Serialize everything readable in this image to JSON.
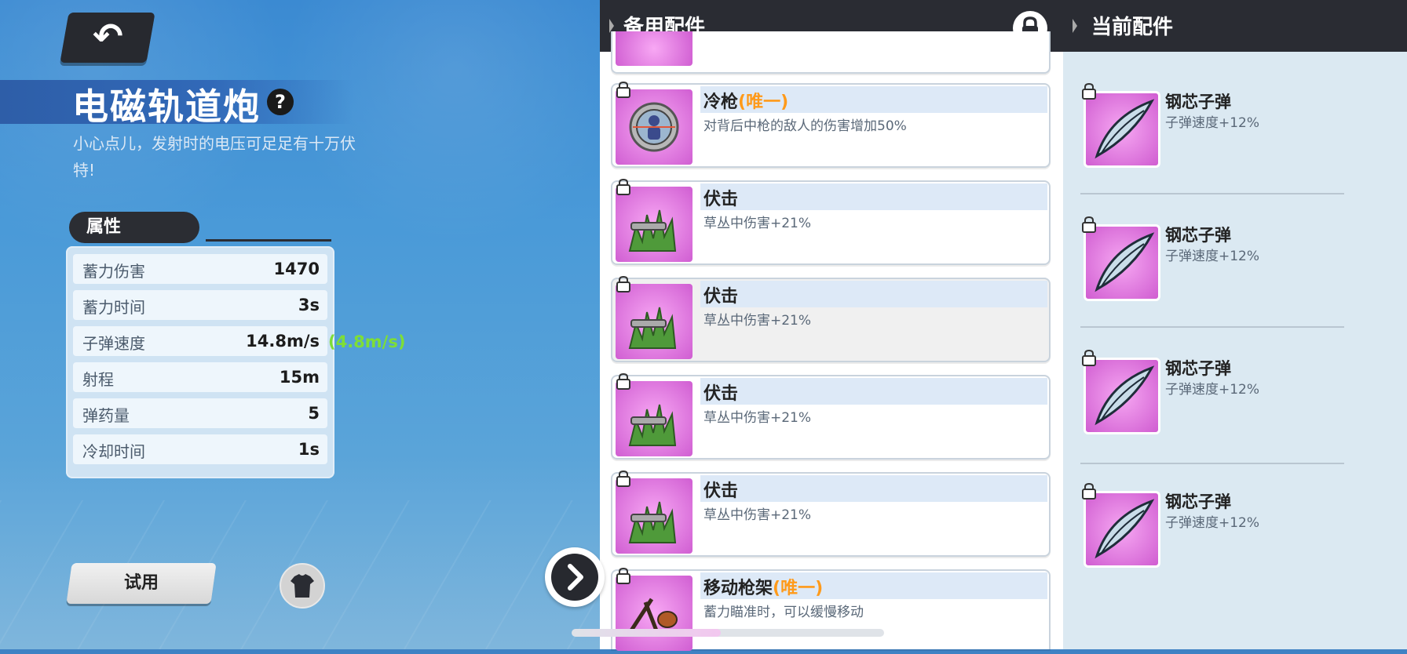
{
  "weapon": {
    "name": "电磁轨道炮",
    "description": "小心点儿，发射时的电压可足足有十万伏特!"
  },
  "attributes": {
    "tab_label": "属性",
    "rows": [
      {
        "label": "蓄力伤害",
        "value": "1470"
      },
      {
        "label": "蓄力时间",
        "value": "3s"
      },
      {
        "label": "子弹速度",
        "value": "14.8m/s"
      },
      {
        "label": "射程",
        "value": "15m"
      },
      {
        "label": "弹药量",
        "value": "5"
      },
      {
        "label": "冷却时间",
        "value": "1s"
      }
    ],
    "bullet_speed_bonus": "(4.8m/s)"
  },
  "buttons": {
    "try_label": "试用"
  },
  "spare_parts": {
    "header": "备用配件",
    "items": [
      {
        "name": "冷枪",
        "tag": "(唯一)",
        "desc": "对背后中枪的敌人的伤害增加50%",
        "icon": "crosshair-icon"
      },
      {
        "name": "伏击",
        "tag": "",
        "desc": "草丛中伤害+21%",
        "icon": "grass-gun-icon"
      },
      {
        "name": "伏击",
        "tag": "",
        "desc": "草丛中伤害+21%",
        "icon": "grass-gun-icon"
      },
      {
        "name": "伏击",
        "tag": "",
        "desc": "草丛中伤害+21%",
        "icon": "grass-gun-icon"
      },
      {
        "name": "伏击",
        "tag": "",
        "desc": "草丛中伤害+21%",
        "icon": "grass-gun-icon"
      },
      {
        "name": "移动枪架",
        "tag": "(唯一)",
        "desc": "蓄力瞄准时，可以缓慢移动",
        "icon": "bipod-icon"
      }
    ]
  },
  "current_parts": {
    "header": "当前配件",
    "items": [
      {
        "name": "钢芯子弹",
        "desc": "子弹速度+12%",
        "icon": "bullet-icon"
      },
      {
        "name": "钢芯子弹",
        "desc": "子弹速度+12%",
        "icon": "bullet-icon"
      },
      {
        "name": "钢芯子弹",
        "desc": "子弹速度+12%",
        "icon": "bullet-icon"
      },
      {
        "name": "钢芯子弹",
        "desc": "子弹速度+12%",
        "icon": "bullet-icon"
      }
    ]
  },
  "colors": {
    "accent_unique": "#ff9a1a",
    "bonus_green": "#7ede36",
    "panel_dark": "#2a2c33",
    "card_icon_bg": "#d05ed2"
  }
}
